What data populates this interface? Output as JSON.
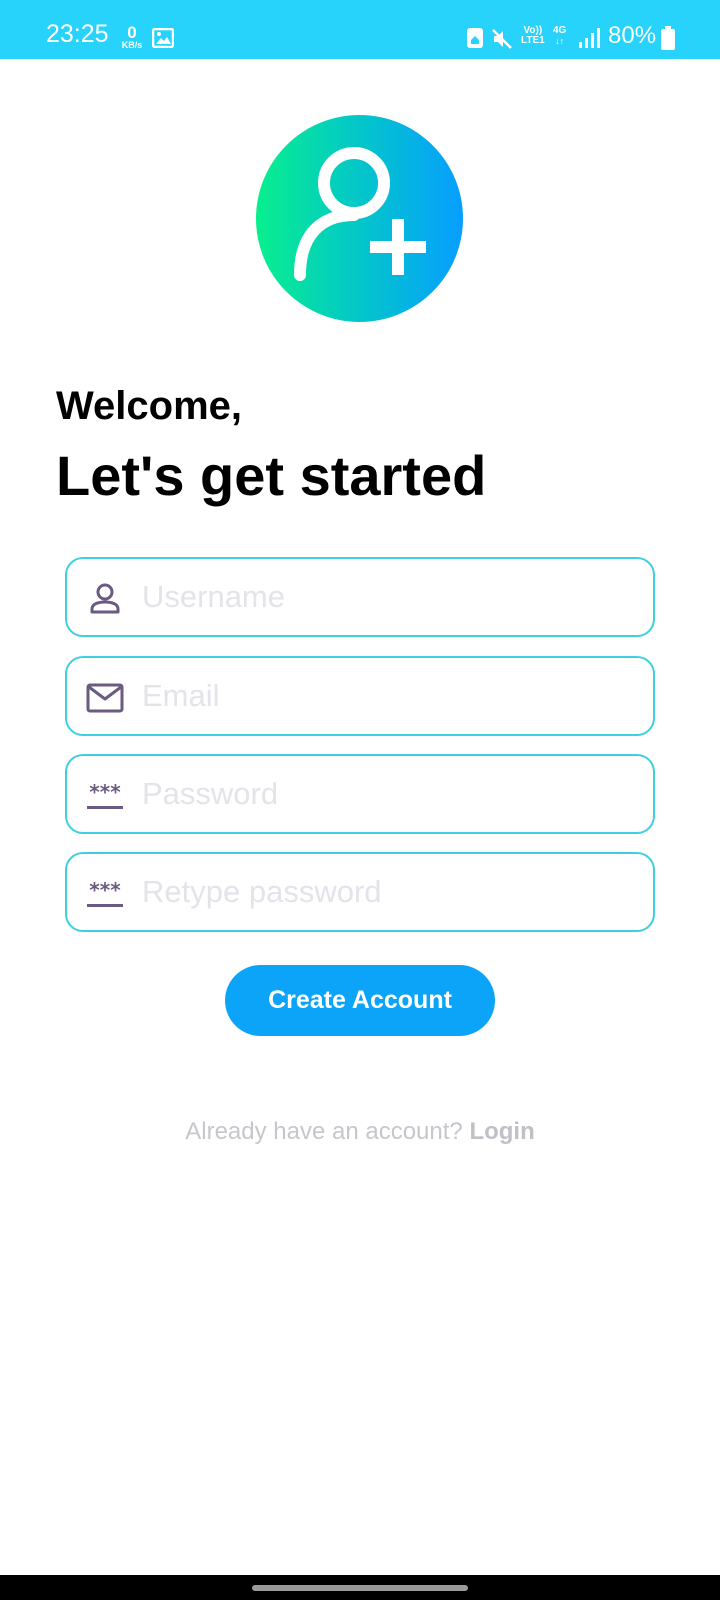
{
  "status_bar": {
    "time": "23:25",
    "net_speed_value": "0",
    "net_speed_unit": "KB/s",
    "volte_line1": "Vo))",
    "volte_line2": "LTE1",
    "network_type": "4G",
    "battery": "80%",
    "icons": [
      "gallery-icon",
      "home-wifi-icon",
      "mute-icon",
      "signal-icon",
      "battery-icon"
    ]
  },
  "header": {
    "welcome": "Welcome,",
    "headline": "Let's get started",
    "avatar_icon": "add-user-icon"
  },
  "form": {
    "username": {
      "placeholder": "Username",
      "value": "",
      "icon": "user-icon"
    },
    "email": {
      "placeholder": "Email",
      "value": "",
      "icon": "mail-icon"
    },
    "password": {
      "placeholder": "Password",
      "value": "",
      "icon": "password-icon"
    },
    "retype_password": {
      "placeholder": "Retype password",
      "value": "",
      "icon": "password-icon"
    },
    "submit_label": "Create Account"
  },
  "footer": {
    "prompt": "Already have an account?",
    "login_label": "Login"
  },
  "colors": {
    "status_bar": "#27d3fb",
    "field_border": "#3ecfe0",
    "button": "#0ca4f8",
    "icon": "#6b5a82"
  }
}
